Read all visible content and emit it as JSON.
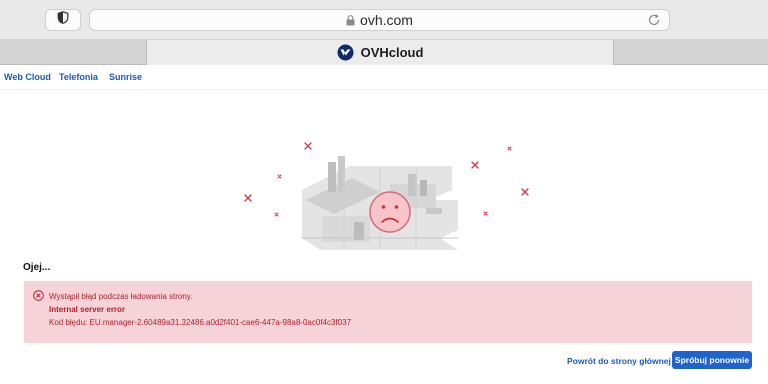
{
  "browser": {
    "url": "ovh.com",
    "tab_title": "OVHcloud"
  },
  "nav": {
    "items": [
      "Web Cloud",
      "Telefonia",
      "Sunrise"
    ]
  },
  "page": {
    "heading": "Ojej...",
    "error": {
      "message": "Wystąpił błąd podczas ładowania strony.",
      "detail": "Internal server error",
      "code": "Kod błędu: EU.manager-2.60489a31.32486.a0d2f401-cae6-447a-98a8-0ac0f4c3f037"
    },
    "actions": {
      "back": "Powrót do strony głównej",
      "retry": "Spróbuj ponownie"
    }
  },
  "colors": {
    "accent": "#1f63cf",
    "link": "#1a5bbf",
    "error_bg": "#f6d3d8",
    "error_text": "#b0222c"
  },
  "icons": [
    "shield-icon",
    "lock-icon",
    "reload-icon",
    "ovh-logo-icon",
    "error-circle-icon",
    "sad-face-icon"
  ]
}
